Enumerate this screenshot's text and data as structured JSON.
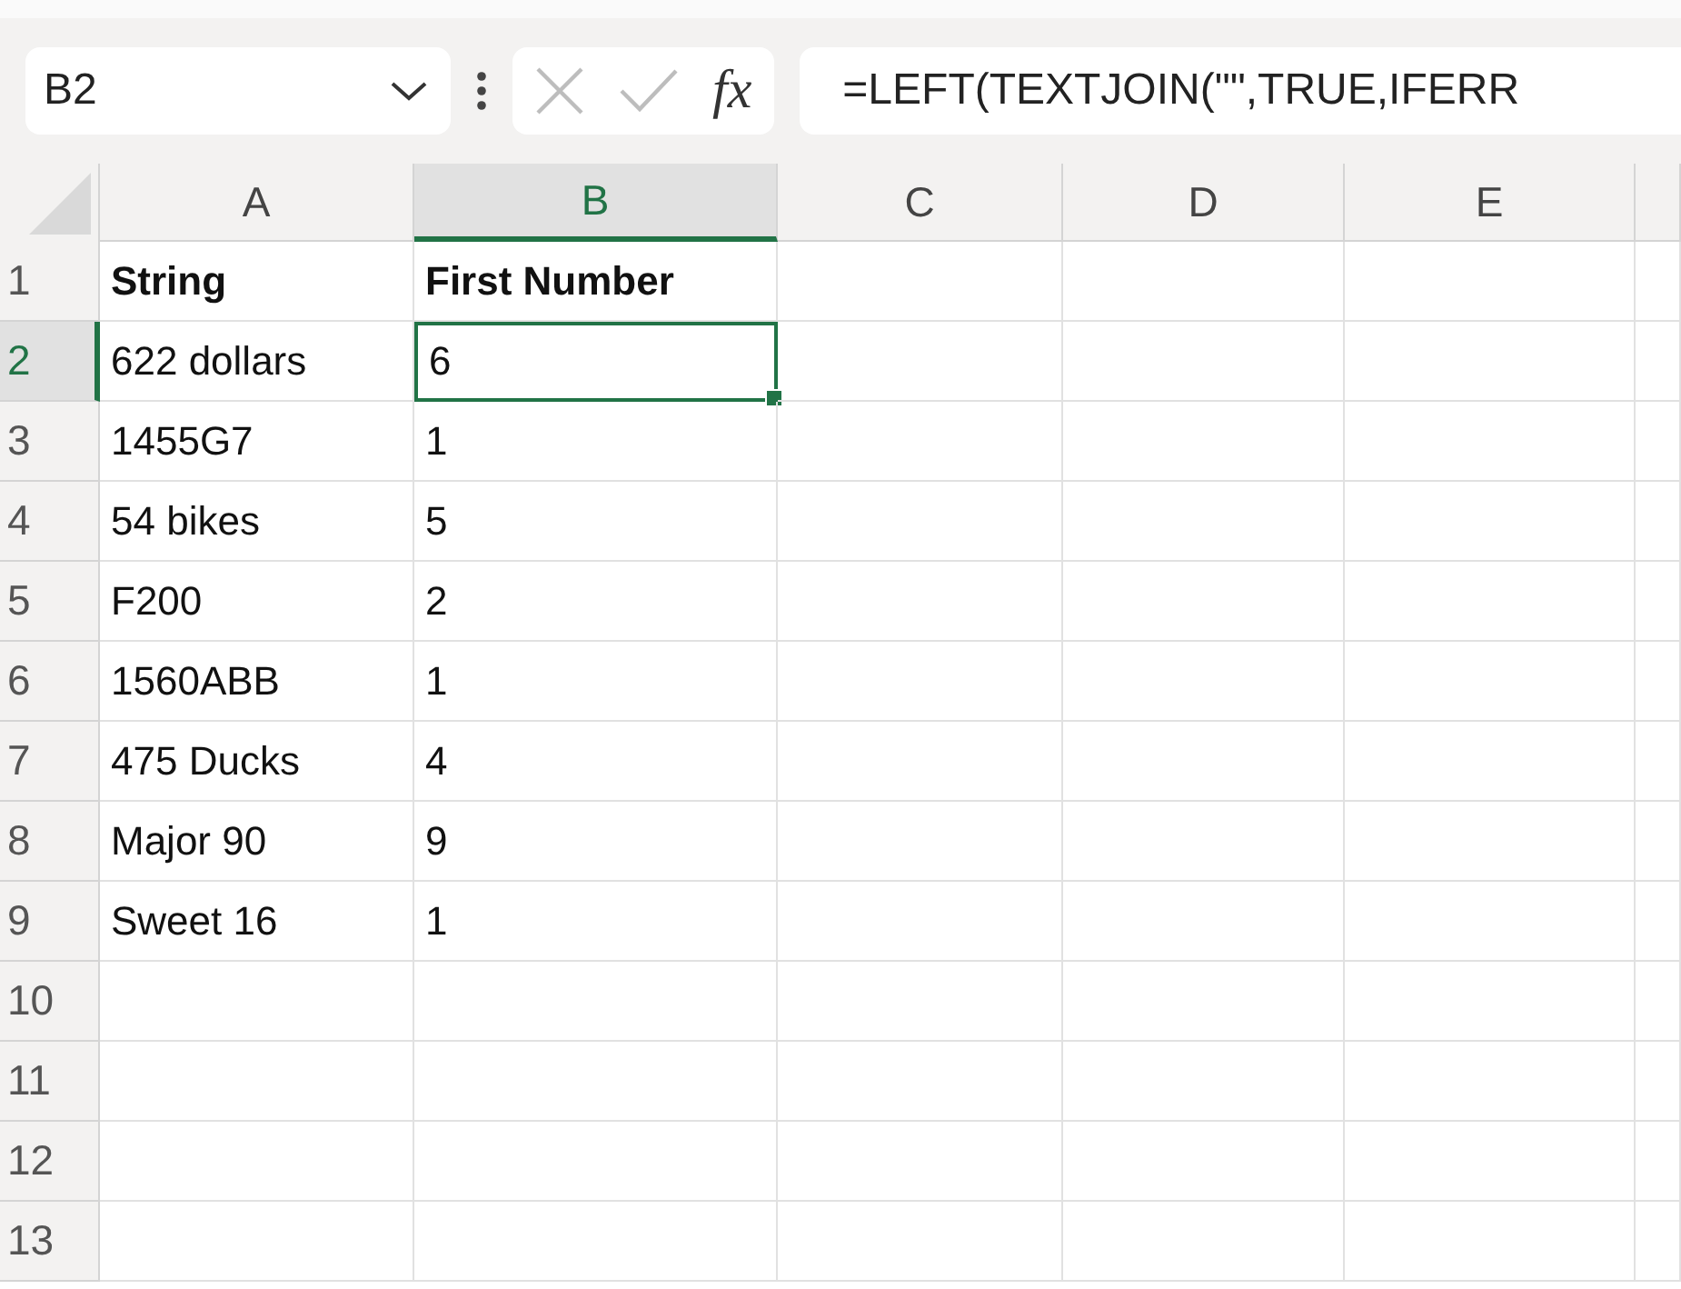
{
  "formula_bar": {
    "name_box": "B2",
    "function_button": "fx",
    "formula": "=LEFT(TEXTJOIN(\"\",TRUE,IFERR"
  },
  "columns": [
    {
      "label": "A",
      "selected": false
    },
    {
      "label": "B",
      "selected": true
    },
    {
      "label": "C",
      "selected": false
    },
    {
      "label": "D",
      "selected": false
    },
    {
      "label": "E",
      "selected": false
    }
  ],
  "rows": [
    {
      "number": "1",
      "selected": false,
      "kind": "header",
      "cells": [
        "String",
        "First Number"
      ]
    },
    {
      "number": "2",
      "selected": true,
      "kind": "data",
      "cells": [
        "622 dollars",
        "6"
      ]
    },
    {
      "number": "3",
      "selected": false,
      "kind": "data",
      "cells": [
        "1455G7",
        "1"
      ]
    },
    {
      "number": "4",
      "selected": false,
      "kind": "data",
      "cells": [
        "54 bikes",
        "5"
      ]
    },
    {
      "number": "5",
      "selected": false,
      "kind": "data",
      "cells": [
        "F200",
        "2"
      ]
    },
    {
      "number": "6",
      "selected": false,
      "kind": "data",
      "cells": [
        "1560ABB",
        "1"
      ]
    },
    {
      "number": "7",
      "selected": false,
      "kind": "data",
      "cells": [
        "475 Ducks",
        "4"
      ]
    },
    {
      "number": "8",
      "selected": false,
      "kind": "data",
      "cells": [
        "Major 90",
        "9"
      ]
    },
    {
      "number": "9",
      "selected": false,
      "kind": "data",
      "cells": [
        "Sweet 16",
        "1"
      ]
    },
    {
      "number": "10",
      "selected": false,
      "kind": "data",
      "cells": []
    },
    {
      "number": "11",
      "selected": false,
      "kind": "data",
      "cells": []
    },
    {
      "number": "12",
      "selected": false,
      "kind": "data",
      "cells": []
    },
    {
      "number": "13",
      "selected": false,
      "kind": "data",
      "cells": []
    }
  ]
}
